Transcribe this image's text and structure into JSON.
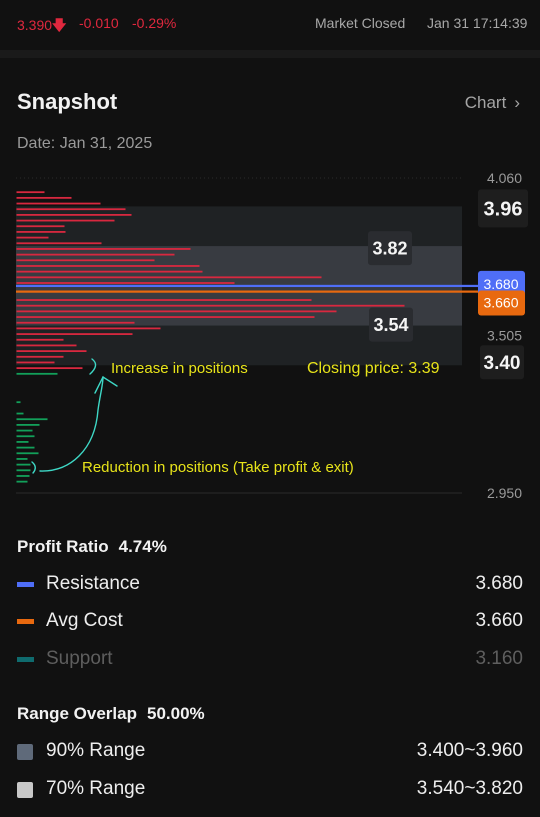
{
  "ticker": {
    "price": "3.390",
    "arrow_icon": "arrow-down-icon",
    "change": "-0.010",
    "change_pct": "-0.29%",
    "market_status": "Market Closed",
    "timestamp": "Jan 31 17:14:39"
  },
  "colors": {
    "down": "#e0283e",
    "resistance": "#4f6ef7",
    "avg_cost": "#e8690f",
    "support": "#0f6b6e",
    "range90": "#5f6a7a",
    "range70": "#c8c8c8",
    "annotation_text": "#e8e41a",
    "annotation_arrow": "#3ed8c6"
  },
  "header": {
    "title": "Snapshot",
    "chart_link": "Chart",
    "date": "Date: Jan 31, 2025"
  },
  "chart_data": {
    "type": "bar",
    "orientation": "horizontal",
    "y_axis": {
      "min": 2.95,
      "max": 4.06,
      "tick_labels": [
        "4.060",
        "3.505",
        "2.950"
      ]
    },
    "profit_bars": {
      "prices": [
        4.01,
        3.99,
        3.97,
        3.95,
        3.93,
        3.91,
        3.89,
        3.87,
        3.85,
        3.83,
        3.81,
        3.79,
        3.77,
        3.75,
        3.73,
        3.71,
        3.69,
        3.63,
        3.61,
        3.59,
        3.57,
        3.55,
        3.53,
        3.51,
        3.49,
        3.47,
        3.45,
        3.43,
        3.41,
        3.39
      ],
      "values": [
        28,
        55,
        84,
        109,
        115,
        98,
        48,
        49,
        32,
        85,
        174,
        158,
        138,
        183,
        186,
        305,
        218,
        295,
        388,
        320,
        298,
        118,
        144,
        116,
        47,
        60,
        70,
        47,
        38,
        66
      ]
    },
    "loss_bars": {
      "prices": [
        3.37,
        3.27,
        3.23,
        3.21,
        3.19,
        3.17,
        3.15,
        3.13,
        3.11,
        3.09,
        3.07,
        3.05,
        3.03,
        3.01,
        2.99
      ],
      "values": [
        39,
        2,
        5,
        29,
        21,
        14,
        16,
        10,
        16,
        20,
        9,
        12,
        12,
        11,
        9
      ]
    },
    "ranges": [
      {
        "name": "90% Range",
        "low": 3.4,
        "high": 3.96,
        "low_label": "3.40",
        "high_label": "3.96"
      },
      {
        "name": "70% Range",
        "low": 3.54,
        "high": 3.82,
        "low_label": "3.54",
        "high_label": "3.82"
      }
    ],
    "lines": [
      {
        "name": "Resistance",
        "value": 3.68,
        "label": "3.680"
      },
      {
        "name": "Avg Cost",
        "value": 3.66,
        "label": "3.660"
      }
    ],
    "annotations": {
      "increase": "Increase in positions",
      "closing": "Closing price: 3.39",
      "reduction": "Reduction in positions (Take profit & exit)"
    }
  },
  "profit": {
    "label": "Profit Ratio",
    "value": "4.74%",
    "items": [
      {
        "label": "Resistance",
        "value": "3.680"
      },
      {
        "label": "Avg Cost",
        "value": "3.660"
      },
      {
        "label": "Support",
        "value": "3.160"
      }
    ]
  },
  "overlap": {
    "label": "Range Overlap",
    "value": "50.00%",
    "items": [
      {
        "label": "90% Range",
        "value": "3.400~3.960"
      },
      {
        "label": "70% Range",
        "value": "3.540~3.820"
      }
    ]
  }
}
